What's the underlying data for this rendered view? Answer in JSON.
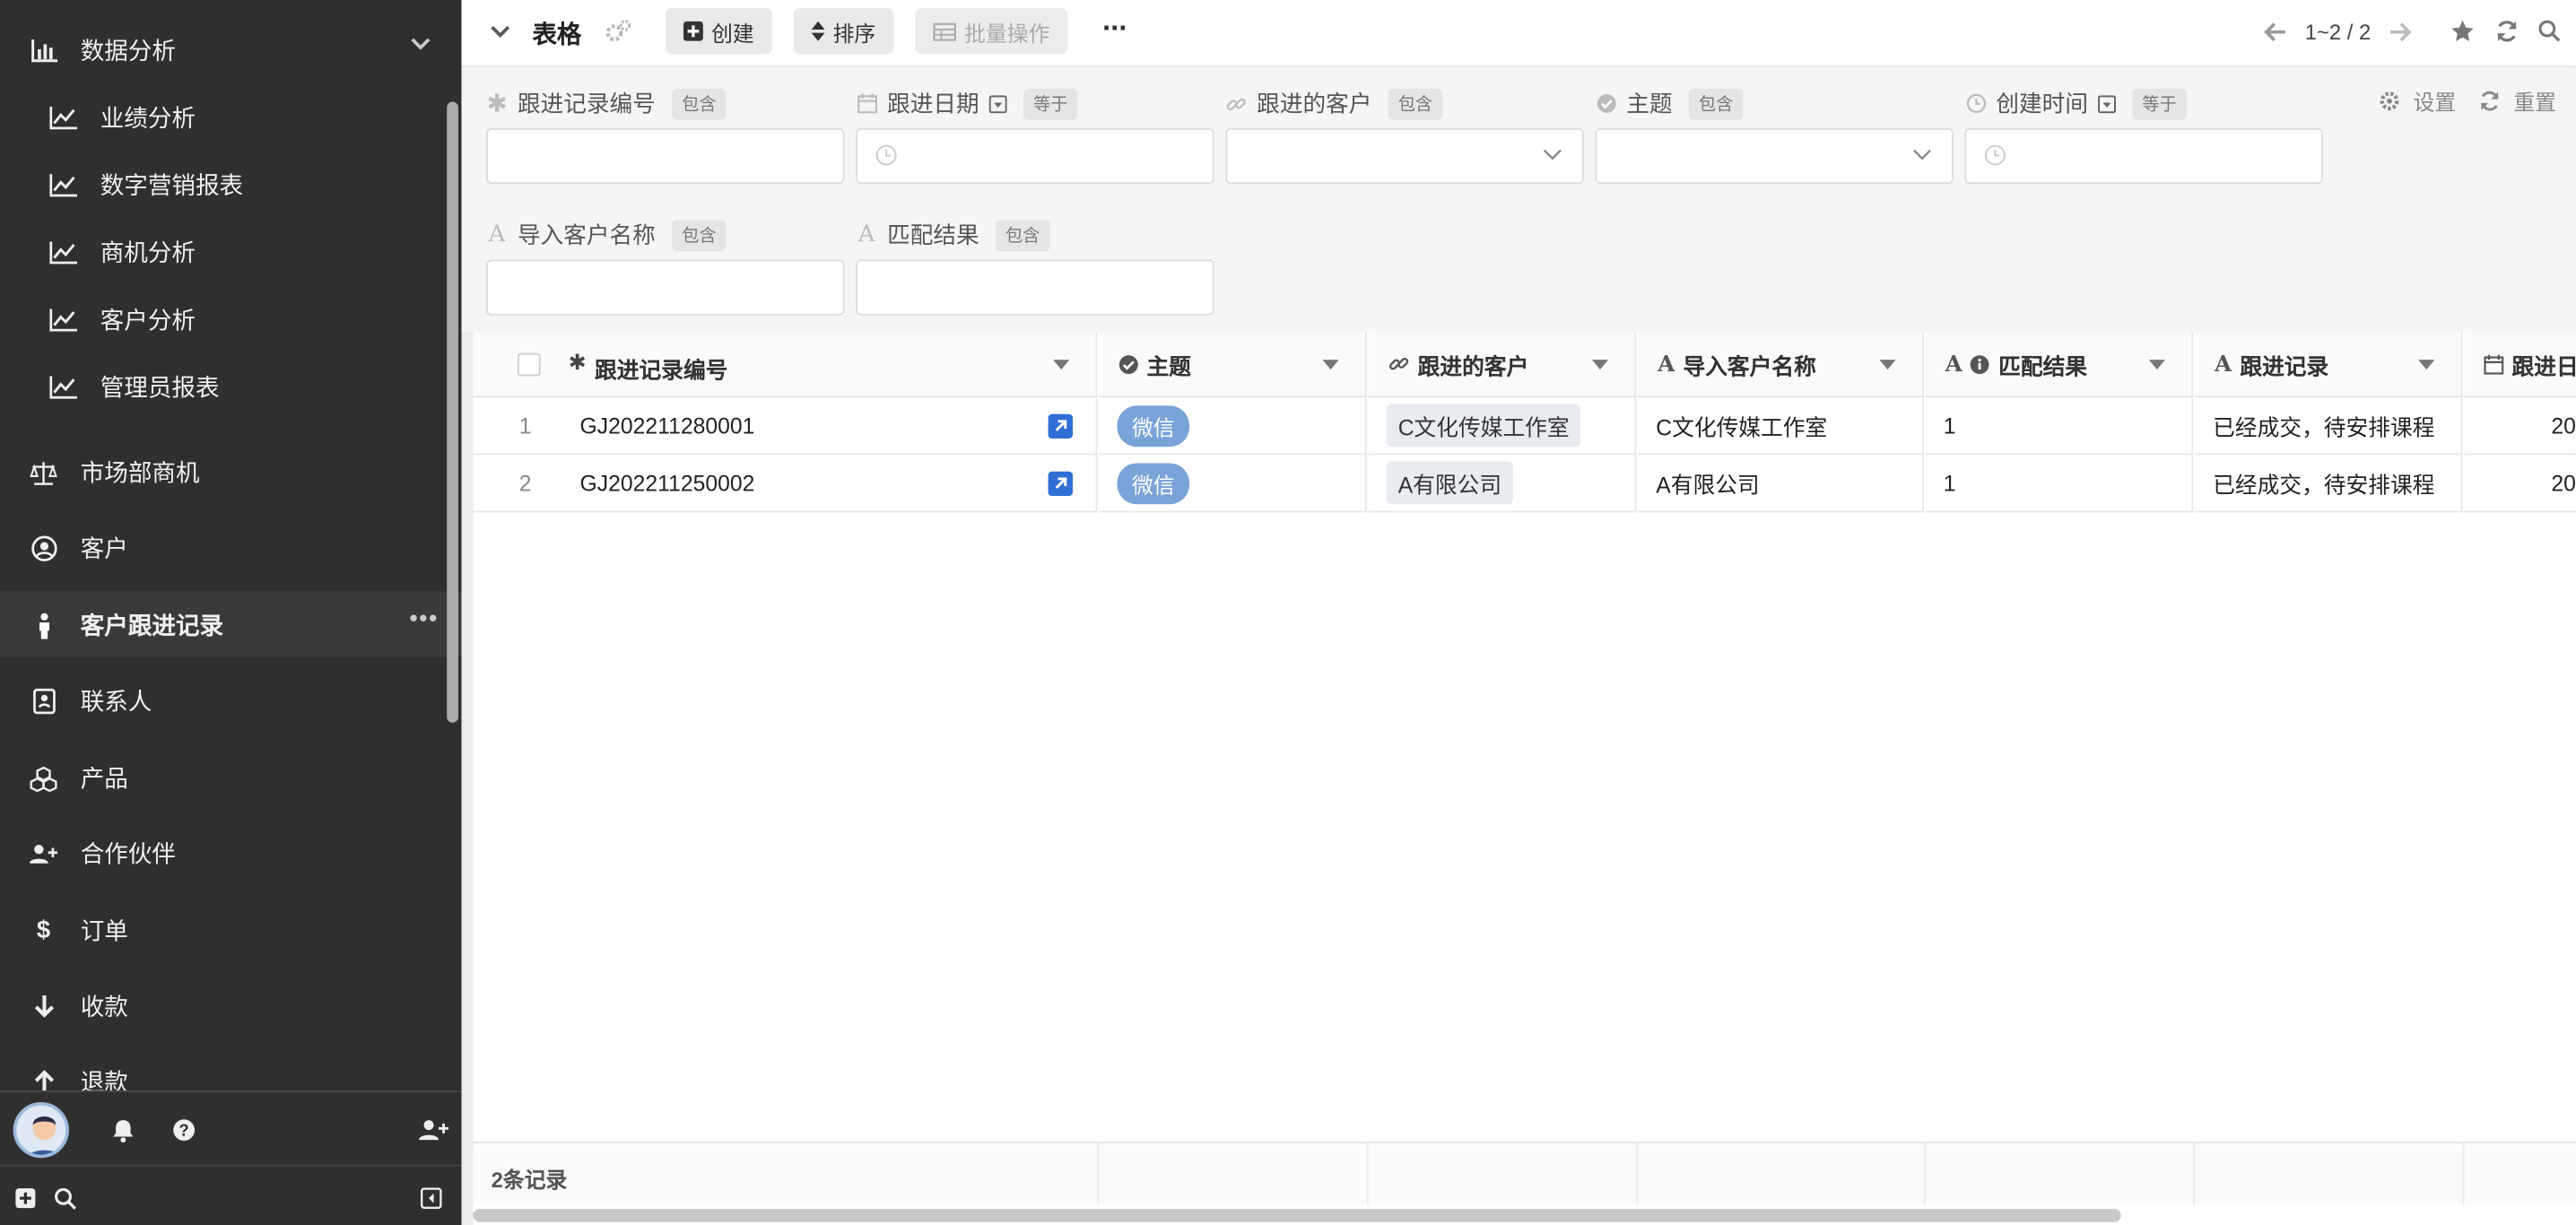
{
  "sidebar": {
    "items": [
      {
        "label": "数据分析",
        "icon": "bar-chart-icon",
        "type": "group"
      },
      {
        "label": "业绩分析",
        "icon": "line-chart-icon",
        "type": "sub"
      },
      {
        "label": "数字营销报表",
        "icon": "line-chart-icon",
        "type": "sub"
      },
      {
        "label": "商机分析",
        "icon": "line-chart-icon",
        "type": "sub"
      },
      {
        "label": "客户分析",
        "icon": "line-chart-icon",
        "type": "sub"
      },
      {
        "label": "管理员报表",
        "icon": "line-chart-icon",
        "type": "sub"
      },
      {
        "label": "市场部商机",
        "icon": "balance-scale-icon"
      },
      {
        "label": "客户",
        "icon": "user-circle-icon"
      },
      {
        "label": "客户跟进记录",
        "icon": "person-icon",
        "active": true
      },
      {
        "label": "联系人",
        "icon": "address-book-icon"
      },
      {
        "label": "产品",
        "icon": "cubes-icon"
      },
      {
        "label": "合作伙伴",
        "icon": "user-plus-icon"
      },
      {
        "label": "订单",
        "icon": "dollar-icon"
      },
      {
        "label": "收款",
        "icon": "arrow-down-icon"
      },
      {
        "label": "退款",
        "icon": "arrow-up-icon"
      }
    ],
    "more_label": "•••"
  },
  "toolbar": {
    "view_title": "表格",
    "create_label": "创建",
    "sort_label": "排序",
    "batch_label": "批量操作",
    "more_label": "···",
    "pagination": "1~2 / 2"
  },
  "filters": {
    "settings_label": "设置",
    "reset_label": "重置",
    "fields": [
      {
        "label": "跟进记录编号",
        "op": "包含",
        "icon": "asterisk-icon"
      },
      {
        "label": "跟进日期",
        "op": "等于",
        "icon": "calendar-icon"
      },
      {
        "label": "跟进的客户",
        "op": "包含",
        "icon": "link-icon"
      },
      {
        "label": "主题",
        "op": "包含",
        "icon": "check-circle-icon"
      },
      {
        "label": "创建时间",
        "op": "等于",
        "icon": "clock-icon"
      },
      {
        "label": "导入客户名称",
        "op": "包含",
        "icon": "text-icon"
      },
      {
        "label": "匹配结果",
        "op": "包含",
        "icon": "text-icon"
      }
    ]
  },
  "table": {
    "columns": [
      "跟进记录编号",
      "主题",
      "跟进的客户",
      "导入客户名称",
      "匹配结果",
      "跟进记录",
      "跟进日"
    ],
    "rows": [
      {
        "index": "1",
        "record_no": "GJ202211280001",
        "topic": "微信",
        "customer": "C文化传媒工作室",
        "import_name": "C文化传媒工作室",
        "match": "1",
        "record": "已经成交，待安排课程",
        "date_partial": "20"
      },
      {
        "index": "2",
        "record_no": "GJ202211250002",
        "topic": "微信",
        "customer": "A有限公司",
        "import_name": "A有限公司",
        "match": "1",
        "record": "已经成交，待安排课程",
        "date_partial": "20"
      }
    ],
    "footer_count": "2条记录"
  },
  "colors": {
    "sidebar_bg": "#2f2f2f",
    "tag_blue": "#7aa3d8",
    "accent": "#3b82f6"
  }
}
